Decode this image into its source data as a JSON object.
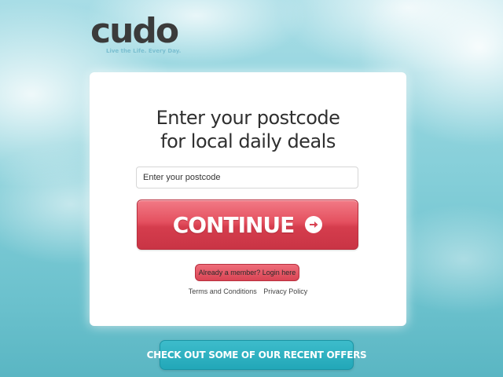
{
  "brand": {
    "logo_text": "cudo",
    "tagline": "Live the Life. Every Day."
  },
  "card": {
    "headline_line1": "Enter your postcode",
    "headline_line2": "for local daily deals",
    "postcode_placeholder": "Enter your postcode",
    "postcode_value": "",
    "continue_label": "CONTINUE",
    "login_label": "Already a member? Login here",
    "links": {
      "terms": "Terms and Conditions",
      "privacy": "Privacy Policy"
    }
  },
  "offers_button_label": "CHECK OUT SOME OF OUR RECENT OFFERS",
  "colors": {
    "brand_red": "#d94454",
    "brand_teal": "#22a7b8",
    "logo_dark": "#3b3b3b",
    "tagline_blue": "#7bbfd0",
    "sky": "#86cfd9"
  },
  "icons": {
    "continue_arrow": "arrow-right-circle-icon"
  }
}
